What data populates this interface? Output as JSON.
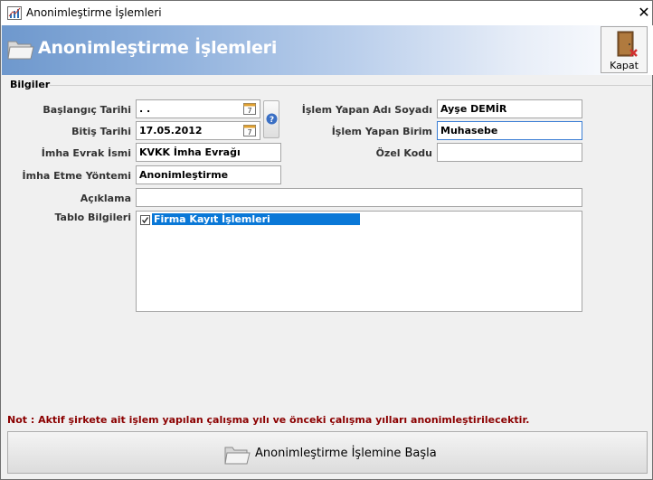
{
  "window": {
    "title": "Anonimleştirme İşlemleri"
  },
  "header": {
    "title": "Anonimleştirme İşlemleri",
    "close_label": "Kapat"
  },
  "section": {
    "title": "Bilgiler"
  },
  "form": {
    "start_date": {
      "label": "Başlangıç Tarihi",
      "value": " . ."
    },
    "end_date": {
      "label": "Bitiş Tarihi",
      "value": "17.05.2012"
    },
    "disposal_doc": {
      "label": "İmha Evrak İsmi",
      "value": "KVKK İmha Evrağı"
    },
    "disposal_method": {
      "label": "İmha Etme Yöntemi",
      "value": "Anonimleştirme"
    },
    "operator_name": {
      "label": "İşlem Yapan Adı Soyadı",
      "value": "Ayşe DEMİR"
    },
    "operator_unit": {
      "label": "İşlem Yapan Birim",
      "value": "Muhasebe"
    },
    "special_code": {
      "label": "Özel Kodu",
      "value": ""
    },
    "description": {
      "label": "Açıklama",
      "value": ""
    },
    "table_info": {
      "label": "Tablo Bilgileri",
      "items": [
        {
          "label": "Firma Kayıt İşlemleri",
          "checked": true,
          "selected": true
        }
      ]
    }
  },
  "note": "Not : Aktif şirkete ait işlem yapılan çalışma yılı ve önceki çalışma yılları anonimleştirilecektir.",
  "actions": {
    "start_label": "Anonimleştirme İşlemine Başla"
  },
  "colors": {
    "header_start": "#6e98cd",
    "selection": "#0a78d7",
    "note": "#8b0000"
  },
  "icons": [
    "app-chart-icon",
    "close-icon",
    "folder-icon",
    "exit-door-icon",
    "calendar-icon",
    "help-icon",
    "checkbox-icon"
  ]
}
